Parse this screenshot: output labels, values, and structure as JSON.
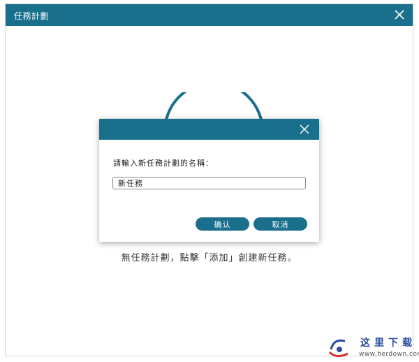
{
  "window": {
    "title": "任務計劃",
    "close_icon": "close-icon"
  },
  "empty_state": {
    "message": "無任務計劃，點擊「添加」創建新任務。"
  },
  "dialog": {
    "close_icon": "close-icon",
    "prompt": "請輸入新任務計劃的名稱：",
    "input_value": "新任務",
    "confirm_label": "确认",
    "cancel_label": "取消"
  },
  "watermark": {
    "text_cn": "这里下载",
    "text_en": "www.herdown.com"
  },
  "colors": {
    "accent": "#1a6f8c",
    "watermark_blue": "#2b4da0",
    "watermark_red": "#d0312d"
  }
}
